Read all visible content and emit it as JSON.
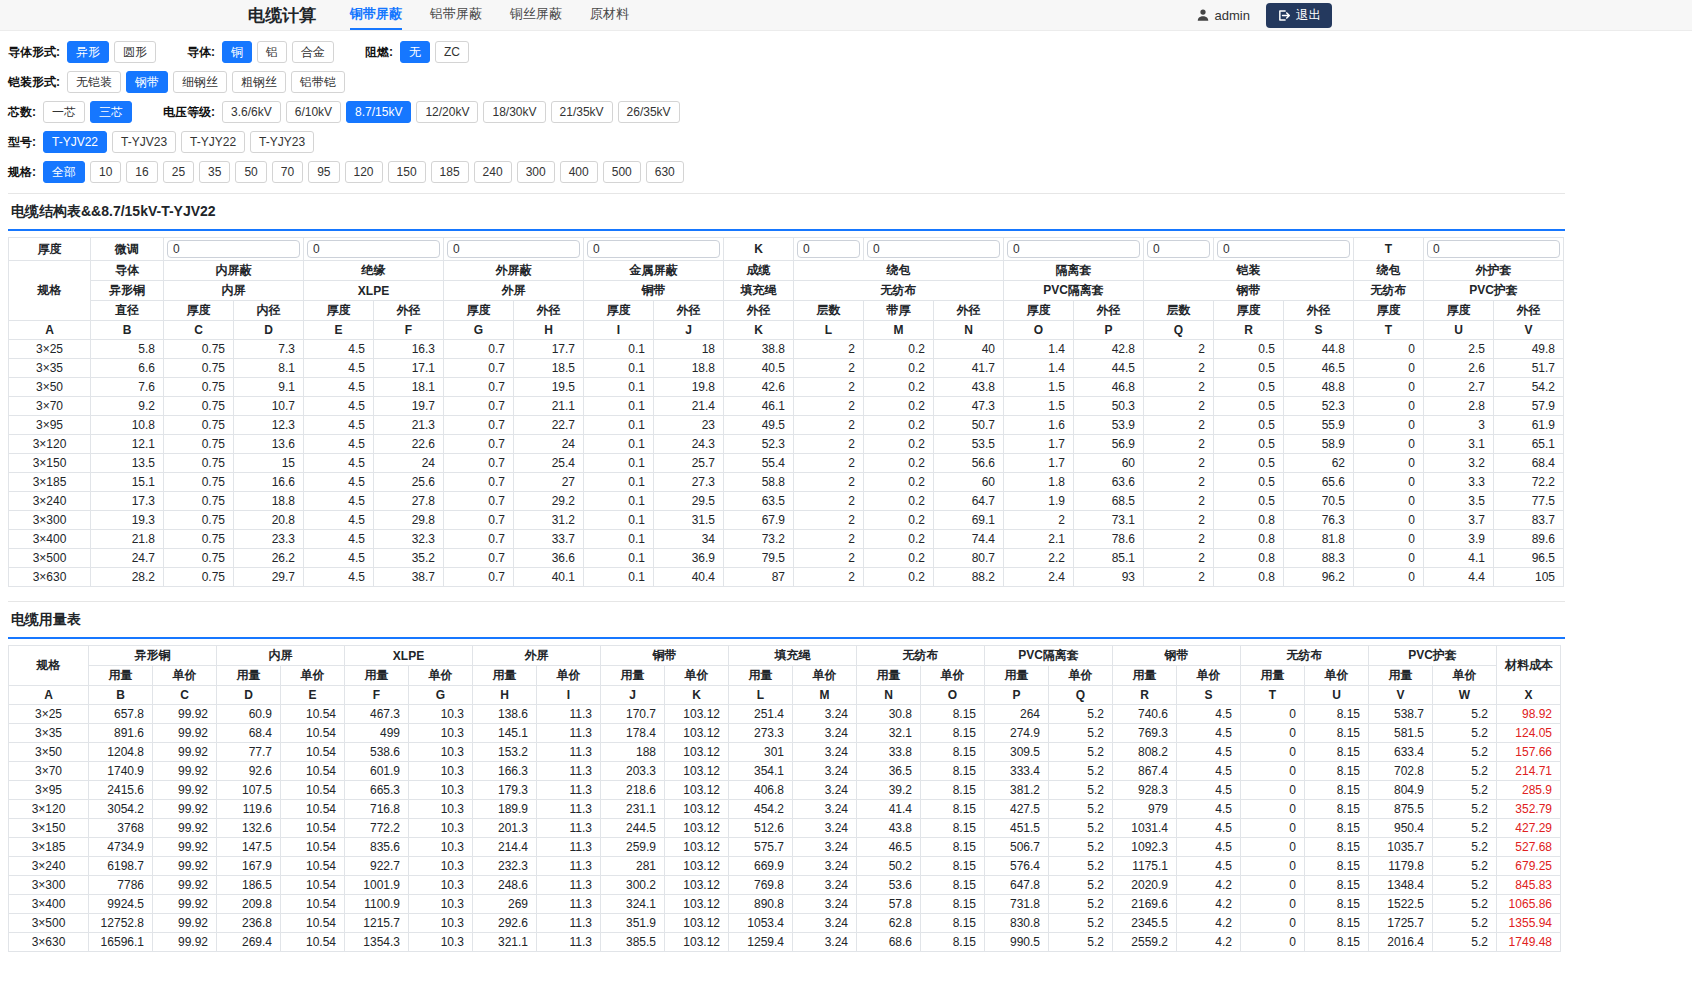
{
  "colors": {
    "accent": "#1677ff",
    "logout_button": "#24395e",
    "cost_text": "#e02020",
    "topbar_bg": "#f7f7f7"
  },
  "navbar": {
    "title": "电缆计算",
    "tabs": [
      {
        "label": "铜带屏蔽",
        "active": true
      },
      {
        "label": "铝带屏蔽",
        "active": false
      },
      {
        "label": "铜丝屏蔽",
        "active": false
      },
      {
        "label": "原材料",
        "active": false
      }
    ],
    "user": "admin",
    "logout_label": "退出"
  },
  "filters": [
    [
      {
        "label": "导体形式:",
        "options": [
          {
            "label": "异形",
            "active": true
          },
          {
            "label": "圆形"
          }
        ]
      },
      {
        "label": "导体:",
        "options": [
          {
            "label": "铜",
            "active": true
          },
          {
            "label": "铝"
          },
          {
            "label": "合金"
          }
        ]
      },
      {
        "label": "阻燃:",
        "options": [
          {
            "label": "无",
            "active": true
          },
          {
            "label": "ZC"
          }
        ]
      }
    ],
    [
      {
        "label": "铠装形式:",
        "options": [
          {
            "label": "无铠装"
          },
          {
            "label": "钢带",
            "active": true
          },
          {
            "label": "细钢丝"
          },
          {
            "label": "粗钢丝"
          },
          {
            "label": "铝带铠"
          }
        ]
      }
    ],
    [
      {
        "label": "芯数:",
        "options": [
          {
            "label": "一芯"
          },
          {
            "label": "三芯",
            "active": true
          }
        ]
      },
      {
        "label": "电压等级:",
        "options": [
          {
            "label": "3.6/6kV"
          },
          {
            "label": "6/10kV"
          },
          {
            "label": "8.7/15kV",
            "active": true
          },
          {
            "label": "12/20kV"
          },
          {
            "label": "18/30kV"
          },
          {
            "label": "21/35kV"
          },
          {
            "label": "26/35kV"
          }
        ]
      }
    ],
    [
      {
        "label": "型号:",
        "options": [
          {
            "label": "T-YJV22",
            "active": true
          },
          {
            "label": "T-YJV23"
          },
          {
            "label": "T-YJY22"
          },
          {
            "label": "T-YJY23"
          }
        ]
      }
    ],
    [
      {
        "label": "规格:",
        "options": [
          {
            "label": "全部",
            "active": true
          },
          {
            "label": "10"
          },
          {
            "label": "16"
          },
          {
            "label": "25"
          },
          {
            "label": "35"
          },
          {
            "label": "50"
          },
          {
            "label": "70"
          },
          {
            "label": "95"
          },
          {
            "label": "120"
          },
          {
            "label": "150"
          },
          {
            "label": "185"
          },
          {
            "label": "240"
          },
          {
            "label": "300"
          },
          {
            "label": "400"
          },
          {
            "label": "500"
          },
          {
            "label": "630"
          }
        ]
      }
    ]
  ],
  "structure_table": {
    "title": "电缆结构表&&8.7/15kV-T-YJV22",
    "header_rows": [
      [
        {
          "label": "厚度"
        },
        {
          "label": "微调"
        },
        {
          "input": "0",
          "colspan": 2
        },
        {
          "input": "0",
          "colspan": 2
        },
        {
          "input": "0",
          "colspan": 2
        },
        {
          "input": "0",
          "colspan": 2
        },
        {
          "label": "K"
        },
        {
          "input": "0"
        },
        {
          "input": "0",
          "colspan": 2
        },
        {
          "input": "0",
          "colspan": 2
        },
        {
          "input": "0"
        },
        {
          "input": "0",
          "colspan": 2
        },
        {
          "label": "T"
        },
        {
          "input": "0",
          "colspan": 2
        }
      ],
      [
        {
          "label": "规格",
          "rowspan": 3
        },
        {
          "label": "导体"
        },
        {
          "label": "内屏蔽",
          "colspan": 2
        },
        {
          "label": "绝缘",
          "colspan": 2
        },
        {
          "label": "外屏蔽",
          "colspan": 2
        },
        {
          "label": "金属屏蔽",
          "colspan": 2
        },
        {
          "label": "成缆"
        },
        {
          "label": "绕包",
          "colspan": 3
        },
        {
          "label": "隔离套",
          "colspan": 2
        },
        {
          "label": "铠装",
          "colspan": 3
        },
        {
          "label": "绕包"
        },
        {
          "label": "外护套",
          "colspan": 2
        }
      ],
      [
        {
          "label": "异形铜"
        },
        {
          "label": "内屏",
          "colspan": 2
        },
        {
          "label": "XLPE",
          "colspan": 2
        },
        {
          "label": "外屏",
          "colspan": 2
        },
        {
          "label": "铜带",
          "colspan": 2
        },
        {
          "label": "填充绳"
        },
        {
          "label": "无纺布",
          "colspan": 3
        },
        {
          "label": "PVC隔离套",
          "colspan": 2
        },
        {
          "label": "钢带",
          "colspan": 3
        },
        {
          "label": "无纺布"
        },
        {
          "label": "PVC护套",
          "colspan": 2
        }
      ],
      [
        "直径",
        "厚度",
        "内径",
        "厚度",
        "外径",
        "厚度",
        "外径",
        "厚度",
        "外径",
        "外径",
        "层数",
        "带厚",
        "外径",
        "厚度",
        "外径",
        "层数",
        "厚度",
        "外径",
        "厚度",
        "厚度",
        "外径"
      ],
      [
        "A",
        "B",
        "C",
        "D",
        "E",
        "F",
        "G",
        "H",
        "I",
        "J",
        "K",
        "L",
        "M",
        "N",
        "O",
        "P",
        "Q",
        "R",
        "S",
        "T",
        "U",
        "V"
      ]
    ],
    "rows": [
      [
        "3×25",
        "5.8",
        "0.75",
        "7.3",
        "4.5",
        "16.3",
        "0.7",
        "17.7",
        "0.1",
        "18",
        "38.8",
        "2",
        "0.2",
        "40",
        "1.4",
        "42.8",
        "2",
        "0.5",
        "44.8",
        "0",
        "2.5",
        "49.8"
      ],
      [
        "3×35",
        "6.6",
        "0.75",
        "8.1",
        "4.5",
        "17.1",
        "0.7",
        "18.5",
        "0.1",
        "18.8",
        "40.5",
        "2",
        "0.2",
        "41.7",
        "1.4",
        "44.5",
        "2",
        "0.5",
        "46.5",
        "0",
        "2.6",
        "51.7"
      ],
      [
        "3×50",
        "7.6",
        "0.75",
        "9.1",
        "4.5",
        "18.1",
        "0.7",
        "19.5",
        "0.1",
        "19.8",
        "42.6",
        "2",
        "0.2",
        "43.8",
        "1.5",
        "46.8",
        "2",
        "0.5",
        "48.8",
        "0",
        "2.7",
        "54.2"
      ],
      [
        "3×70",
        "9.2",
        "0.75",
        "10.7",
        "4.5",
        "19.7",
        "0.7",
        "21.1",
        "0.1",
        "21.4",
        "46.1",
        "2",
        "0.2",
        "47.3",
        "1.5",
        "50.3",
        "2",
        "0.5",
        "52.3",
        "0",
        "2.8",
        "57.9"
      ],
      [
        "3×95",
        "10.8",
        "0.75",
        "12.3",
        "4.5",
        "21.3",
        "0.7",
        "22.7",
        "0.1",
        "23",
        "49.5",
        "2",
        "0.2",
        "50.7",
        "1.6",
        "53.9",
        "2",
        "0.5",
        "55.9",
        "0",
        "3",
        "61.9"
      ],
      [
        "3×120",
        "12.1",
        "0.75",
        "13.6",
        "4.5",
        "22.6",
        "0.7",
        "24",
        "0.1",
        "24.3",
        "52.3",
        "2",
        "0.2",
        "53.5",
        "1.7",
        "56.9",
        "2",
        "0.5",
        "58.9",
        "0",
        "3.1",
        "65.1"
      ],
      [
        "3×150",
        "13.5",
        "0.75",
        "15",
        "4.5",
        "24",
        "0.7",
        "25.4",
        "0.1",
        "25.7",
        "55.4",
        "2",
        "0.2",
        "56.6",
        "1.7",
        "60",
        "2",
        "0.5",
        "62",
        "0",
        "3.2",
        "68.4"
      ],
      [
        "3×185",
        "15.1",
        "0.75",
        "16.6",
        "4.5",
        "25.6",
        "0.7",
        "27",
        "0.1",
        "27.3",
        "58.8",
        "2",
        "0.2",
        "60",
        "1.8",
        "63.6",
        "2",
        "0.5",
        "65.6",
        "0",
        "3.3",
        "72.2"
      ],
      [
        "3×240",
        "17.3",
        "0.75",
        "18.8",
        "4.5",
        "27.8",
        "0.7",
        "29.2",
        "0.1",
        "29.5",
        "63.5",
        "2",
        "0.2",
        "64.7",
        "1.9",
        "68.5",
        "2",
        "0.5",
        "70.5",
        "0",
        "3.5",
        "77.5"
      ],
      [
        "3×300",
        "19.3",
        "0.75",
        "20.8",
        "4.5",
        "29.8",
        "0.7",
        "31.2",
        "0.1",
        "31.5",
        "67.9",
        "2",
        "0.2",
        "69.1",
        "2",
        "73.1",
        "2",
        "0.8",
        "76.3",
        "0",
        "3.7",
        "83.7"
      ],
      [
        "3×400",
        "21.8",
        "0.75",
        "23.3",
        "4.5",
        "32.3",
        "0.7",
        "33.7",
        "0.1",
        "34",
        "73.2",
        "2",
        "0.2",
        "74.4",
        "2.1",
        "78.6",
        "2",
        "0.8",
        "81.8",
        "0",
        "3.9",
        "89.6"
      ],
      [
        "3×500",
        "24.7",
        "0.75",
        "26.2",
        "4.5",
        "35.2",
        "0.7",
        "36.6",
        "0.1",
        "36.9",
        "79.5",
        "2",
        "0.2",
        "80.7",
        "2.2",
        "85.1",
        "2",
        "0.8",
        "88.3",
        "0",
        "4.1",
        "96.5"
      ],
      [
        "3×630",
        "28.2",
        "0.75",
        "29.7",
        "4.5",
        "38.7",
        "0.7",
        "40.1",
        "0.1",
        "40.4",
        "87",
        "2",
        "0.2",
        "88.2",
        "2.4",
        "93",
        "2",
        "0.8",
        "96.2",
        "0",
        "4.4",
        "105"
      ]
    ]
  },
  "usage_table": {
    "title": "电缆用量表",
    "cost_last_col": true,
    "header_rows": [
      [
        {
          "label": "规格",
          "rowspan": 2
        },
        {
          "label": "异形铜",
          "colspan": 2
        },
        {
          "label": "内屏",
          "colspan": 2
        },
        {
          "label": "XLPE",
          "colspan": 2
        },
        {
          "label": "外屏",
          "colspan": 2
        },
        {
          "label": "铜带",
          "colspan": 2
        },
        {
          "label": "填充绳",
          "colspan": 2
        },
        {
          "label": "无纺布",
          "colspan": 2
        },
        {
          "label": "PVC隔离套",
          "colspan": 2
        },
        {
          "label": "钢带",
          "colspan": 2
        },
        {
          "label": "无纺布",
          "colspan": 2
        },
        {
          "label": "PVC护套",
          "colspan": 2
        },
        {
          "label": "材料成本",
          "rowspan": 2
        }
      ],
      [
        "用量",
        "单价",
        "用量",
        "单价",
        "用量",
        "单价",
        "用量",
        "单价",
        "用量",
        "单价",
        "用量",
        "单价",
        "用量",
        "单价",
        "用量",
        "单价",
        "用量",
        "单价",
        "用量",
        "单价",
        "用量",
        "单价"
      ],
      [
        "A",
        "B",
        "C",
        "D",
        "E",
        "F",
        "G",
        "H",
        "I",
        "J",
        "K",
        "L",
        "M",
        "N",
        "O",
        "P",
        "Q",
        "R",
        "S",
        "T",
        "U",
        "V",
        "W",
        "X"
      ]
    ],
    "rows": [
      [
        "3×25",
        "657.8",
        "99.92",
        "60.9",
        "10.54",
        "467.3",
        "10.3",
        "138.6",
        "11.3",
        "170.7",
        "103.12",
        "251.4",
        "3.24",
        "30.8",
        "8.15",
        "264",
        "5.2",
        "740.6",
        "4.5",
        "0",
        "8.15",
        "538.7",
        "5.2",
        "98.92"
      ],
      [
        "3×35",
        "891.6",
        "99.92",
        "68.4",
        "10.54",
        "499",
        "10.3",
        "145.1",
        "11.3",
        "178.4",
        "103.12",
        "273.3",
        "3.24",
        "32.1",
        "8.15",
        "274.9",
        "5.2",
        "769.3",
        "4.5",
        "0",
        "8.15",
        "581.5",
        "5.2",
        "124.05"
      ],
      [
        "3×50",
        "1204.8",
        "99.92",
        "77.7",
        "10.54",
        "538.6",
        "10.3",
        "153.2",
        "11.3",
        "188",
        "103.12",
        "301",
        "3.24",
        "33.8",
        "8.15",
        "309.5",
        "5.2",
        "808.2",
        "4.5",
        "0",
        "8.15",
        "633.4",
        "5.2",
        "157.66"
      ],
      [
        "3×70",
        "1740.9",
        "99.92",
        "92.6",
        "10.54",
        "601.9",
        "10.3",
        "166.3",
        "11.3",
        "203.3",
        "103.12",
        "354.1",
        "3.24",
        "36.5",
        "8.15",
        "333.4",
        "5.2",
        "867.4",
        "4.5",
        "0",
        "8.15",
        "702.8",
        "5.2",
        "214.71"
      ],
      [
        "3×95",
        "2415.6",
        "99.92",
        "107.5",
        "10.54",
        "665.3",
        "10.3",
        "179.3",
        "11.3",
        "218.6",
        "103.12",
        "406.8",
        "3.24",
        "39.2",
        "8.15",
        "381.2",
        "5.2",
        "928.3",
        "4.5",
        "0",
        "8.15",
        "804.9",
        "5.2",
        "285.9"
      ],
      [
        "3×120",
        "3054.2",
        "99.92",
        "119.6",
        "10.54",
        "716.8",
        "10.3",
        "189.9",
        "11.3",
        "231.1",
        "103.12",
        "454.2",
        "3.24",
        "41.4",
        "8.15",
        "427.5",
        "5.2",
        "979",
        "4.5",
        "0",
        "8.15",
        "875.5",
        "5.2",
        "352.79"
      ],
      [
        "3×150",
        "3768",
        "99.92",
        "132.6",
        "10.54",
        "772.2",
        "10.3",
        "201.3",
        "11.3",
        "244.5",
        "103.12",
        "512.6",
        "3.24",
        "43.8",
        "8.15",
        "451.5",
        "5.2",
        "1031.4",
        "4.5",
        "0",
        "8.15",
        "950.4",
        "5.2",
        "427.29"
      ],
      [
        "3×185",
        "4734.9",
        "99.92",
        "147.5",
        "10.54",
        "835.6",
        "10.3",
        "214.4",
        "11.3",
        "259.9",
        "103.12",
        "575.7",
        "3.24",
        "46.5",
        "8.15",
        "506.7",
        "5.2",
        "1092.3",
        "4.5",
        "0",
        "8.15",
        "1035.7",
        "5.2",
        "527.68"
      ],
      [
        "3×240",
        "6198.7",
        "99.92",
        "167.9",
        "10.54",
        "922.7",
        "10.3",
        "232.3",
        "11.3",
        "281",
        "103.12",
        "669.9",
        "3.24",
        "50.2",
        "8.15",
        "576.4",
        "5.2",
        "1175.1",
        "4.5",
        "0",
        "8.15",
        "1179.8",
        "5.2",
        "679.25"
      ],
      [
        "3×300",
        "7786",
        "99.92",
        "186.5",
        "10.54",
        "1001.9",
        "10.3",
        "248.6",
        "11.3",
        "300.2",
        "103.12",
        "769.8",
        "3.24",
        "53.6",
        "8.15",
        "647.8",
        "5.2",
        "2020.9",
        "4.2",
        "0",
        "8.15",
        "1348.4",
        "5.2",
        "845.83"
      ],
      [
        "3×400",
        "9924.5",
        "99.92",
        "209.8",
        "10.54",
        "1100.9",
        "10.3",
        "269",
        "11.3",
        "324.1",
        "103.12",
        "890.8",
        "3.24",
        "57.8",
        "8.15",
        "731.8",
        "5.2",
        "2169.6",
        "4.2",
        "0",
        "8.15",
        "1522.5",
        "5.2",
        "1065.86"
      ],
      [
        "3×500",
        "12752.8",
        "99.92",
        "236.8",
        "10.54",
        "1215.7",
        "10.3",
        "292.6",
        "11.3",
        "351.9",
        "103.12",
        "1053.4",
        "3.24",
        "62.8",
        "8.15",
        "830.8",
        "5.2",
        "2345.5",
        "4.2",
        "0",
        "8.15",
        "1725.7",
        "5.2",
        "1355.94"
      ],
      [
        "3×630",
        "16596.1",
        "99.92",
        "269.4",
        "10.54",
        "1354.3",
        "10.3",
        "321.1",
        "11.3",
        "385.5",
        "103.12",
        "1259.4",
        "3.24",
        "68.6",
        "8.15",
        "990.5",
        "5.2",
        "2559.2",
        "4.2",
        "0",
        "8.15",
        "2016.4",
        "5.2",
        "1749.48"
      ]
    ]
  }
}
